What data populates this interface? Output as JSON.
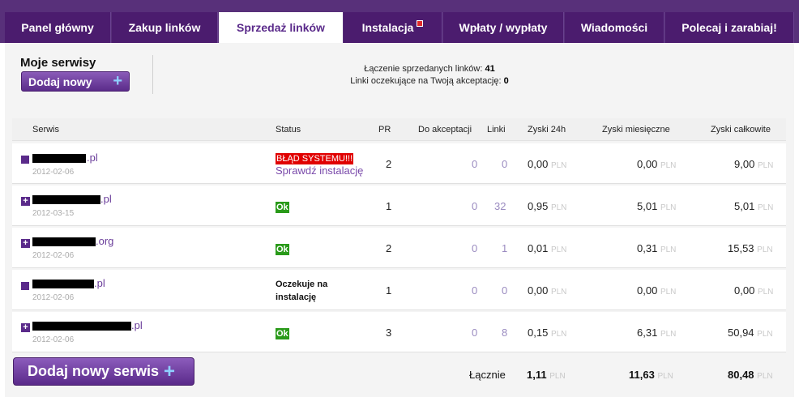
{
  "nav": {
    "tabs": [
      {
        "label": "Panel główny"
      },
      {
        "label": "Zakup linków"
      },
      {
        "label": "Sprzedaż linków"
      },
      {
        "label": "Instalacja"
      },
      {
        "label": "Wpłaty / wypłaty"
      },
      {
        "label": "Wiadomości"
      },
      {
        "label": "Polecaj i zarabiaj!"
      }
    ]
  },
  "header": {
    "title": "Moje serwisy",
    "add_label": "Dodaj nowy",
    "stat1_label": "Łączenie sprzedanych linków:",
    "stat1_value": "41",
    "stat2_label": "Linki oczekujące na Twoją akceptację:",
    "stat2_value": "0"
  },
  "table": {
    "columns": [
      "Serwis",
      "Status",
      "PR",
      "Do akceptacji",
      "Linki",
      "Zyski 24h",
      "Zyski miesięczne",
      "Zyski całkowite"
    ],
    "currency": "PLN",
    "rows": [
      {
        "tld": ".pl",
        "date": "2012-02-06",
        "status_error": "BŁĄD SYSTEMU!!!",
        "status_link": "Sprawdź instalację",
        "pr": "2",
        "accept": "0",
        "links": "0",
        "z24": "0,00",
        "zm": "0,00",
        "zt": "9,00"
      },
      {
        "tld": ".pl",
        "date": "2012-03-15",
        "status_ok": "Ok",
        "pr": "1",
        "accept": "0",
        "links": "32",
        "z24": "0,95",
        "zm": "5,01",
        "zt": "5,01"
      },
      {
        "tld": ".org",
        "date": "2012-02-06",
        "status_ok": "Ok",
        "pr": "2",
        "accept": "0",
        "links": "1",
        "z24": "0,01",
        "zm": "0,31",
        "zt": "15,53"
      },
      {
        "tld": ".pl",
        "date": "2012-02-06",
        "status_wait": "Oczekuje na instalację",
        "pr": "1",
        "accept": "0",
        "links": "0",
        "z24": "0,00",
        "zm": "0,00",
        "zt": "0,00"
      },
      {
        "tld": ".pl",
        "date": "2012-02-06",
        "status_ok": "Ok",
        "pr": "3",
        "accept": "0",
        "links": "8",
        "z24": "0,15",
        "zm": "6,31",
        "zt": "50,94"
      }
    ]
  },
  "footer": {
    "add_service_label": "Dodaj nowy serwis",
    "total_label": "Łącznie",
    "total_24h": "1,11",
    "total_month": "11,63",
    "total_all": "80,48"
  }
}
